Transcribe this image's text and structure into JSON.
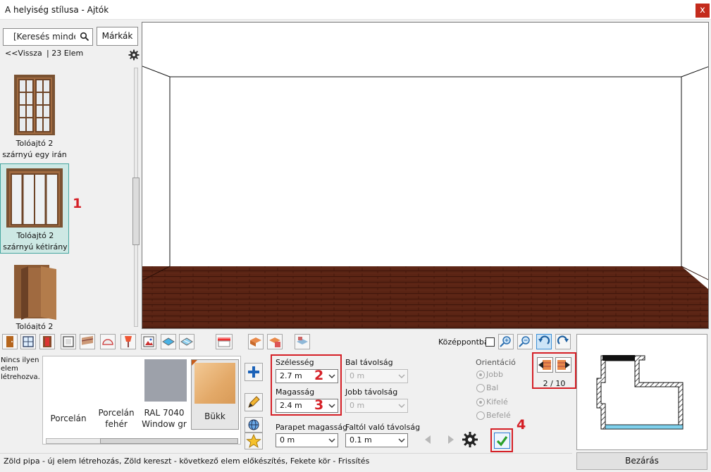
{
  "window": {
    "title": "A helyiség stílusa - Ajtók",
    "close_label": "x"
  },
  "left_panel": {
    "search_placeholder": "[Keresés minden",
    "brands_button": "Márkák",
    "back_link": "<<Vissza",
    "item_count": "| 23 Elem",
    "items": [
      {
        "line1": "Tolóajtó 2",
        "line2": "szárnyú  egy irán",
        "selected": false
      },
      {
        "line1": "Tolóajtó 2",
        "line2": "szárnyú  kétirány",
        "selected": true
      },
      {
        "line1": "Tolóajtó 2",
        "line2": "",
        "selected": false
      }
    ],
    "marker": "1"
  },
  "toolbar": {
    "center_label": "Középpontba"
  },
  "materials": {
    "empty_note": "Nincs ilyen elem létrehozva.",
    "swatches": [
      {
        "label_1": "Porcelán",
        "label_2": "",
        "color": "#ffffff"
      },
      {
        "label_1": "Porcelán",
        "label_2": "fehér",
        "color": "#ffffff"
      },
      {
        "label_1": "RAL 7040",
        "label_2": "Window gr",
        "color": "#9da1aa"
      },
      {
        "label_1": "Bükk",
        "label_2": "",
        "color": "#e8b47a",
        "selected": true
      }
    ]
  },
  "dimensions": {
    "width_label": "Szélesség",
    "width_value": "2.7 m",
    "width_marker": "2",
    "height_label": "Magasság",
    "height_value": "2.4 m",
    "height_marker": "3",
    "parapet_label": "Parapet magasság",
    "parapet_value": "0 m",
    "left_dist_label": "Bal távolság",
    "left_dist_value": "0 m",
    "right_dist_label": "Jobb távolság",
    "right_dist_value": "0 m",
    "wall_dist_label": "Faltól való távolság",
    "wall_dist_value": "0.1 m"
  },
  "orientation": {
    "title": "Orientáció",
    "options": [
      {
        "label": "Jobb",
        "checked": true
      },
      {
        "label": "Bal",
        "checked": false
      },
      {
        "label": "Kifelé",
        "checked": true
      },
      {
        "label": "Befelé",
        "checked": false
      }
    ]
  },
  "confirm_marker": "4",
  "pager": {
    "label": "2 / 10"
  },
  "close_button": "Bezárás",
  "status": "Zöld pipa - új elem létrehozás, Zöld kereszt - következő elem előkészítés, Fekete kör - Frissítés",
  "colors": {
    "accent_red": "#d51f26",
    "selection_bg": "#cde8e4",
    "selection_border": "#47a6a0",
    "floor": "#5a2414",
    "water": "#7fd0ec"
  }
}
